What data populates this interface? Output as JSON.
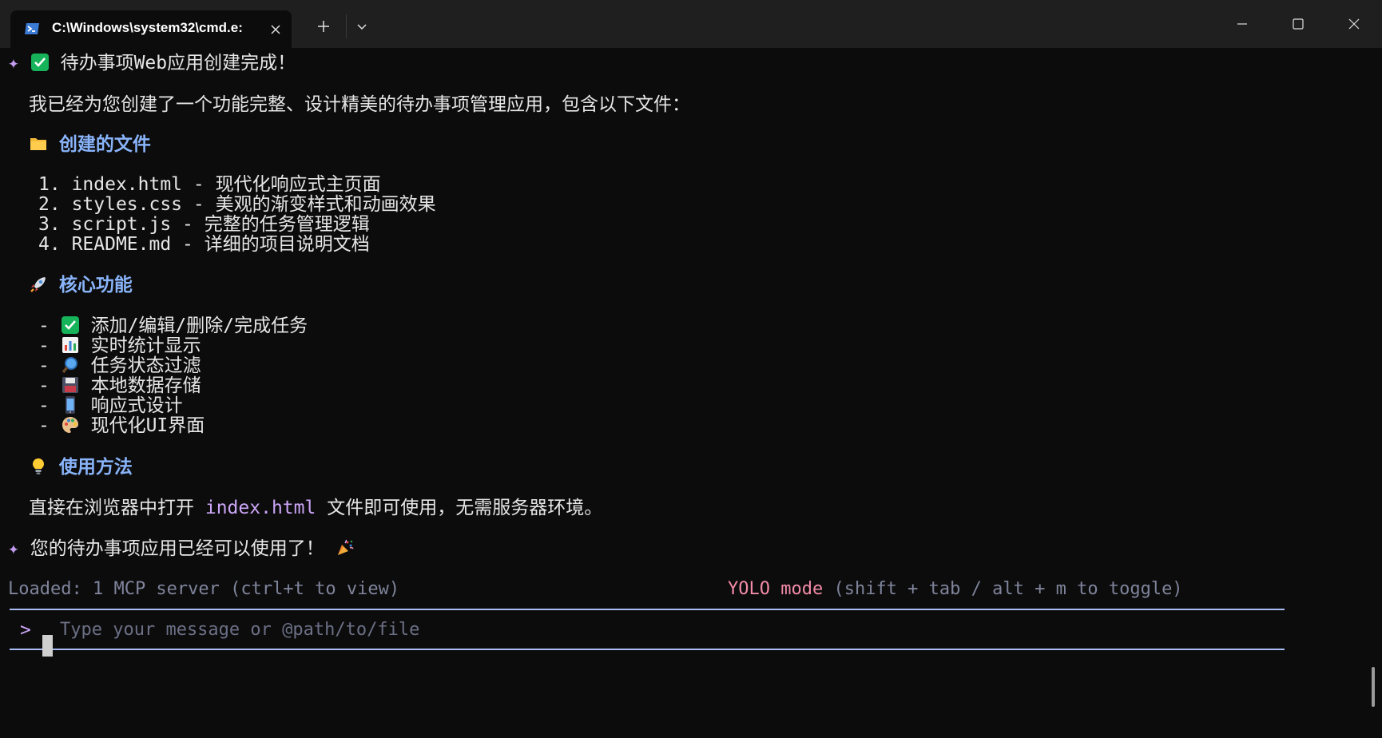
{
  "window": {
    "tab_title": "C:\\Windows\\system32\\cmd.e:",
    "icons": {
      "tab": "powershell-icon",
      "close_tab": "close-icon",
      "new_tab": "plus-icon",
      "dropdown": "chevron-down-icon",
      "minimize": "minimize-icon",
      "maximize": "maximize-icon",
      "close": "close-icon"
    }
  },
  "message": {
    "title": "待办事项Web应用创建完成！",
    "intro": "我已经为您创建了一个功能完整、设计精美的待办事项管理应用，包含以下文件：",
    "files_heading": "创建的文件",
    "files": [
      {
        "num": "1.",
        "name": "index.html",
        "desc": "现代化响应式主页面"
      },
      {
        "num": "2.",
        "name": "styles.css",
        "desc": "美观的渐变样式和动画效果"
      },
      {
        "num": "3.",
        "name": "script.js",
        "desc": "完整的任务管理逻辑"
      },
      {
        "num": "4.",
        "name": "README.md",
        "desc": "详细的项目说明文档"
      }
    ],
    "features_heading": "核心功能",
    "features": [
      {
        "icon": "check-icon",
        "text": "添加/编辑/删除/完成任务"
      },
      {
        "icon": "chart-icon",
        "text": "实时统计显示"
      },
      {
        "icon": "magnifier-icon",
        "text": "任务状态过滤"
      },
      {
        "icon": "floppy-disk-icon",
        "text": "本地数据存储"
      },
      {
        "icon": "mobile-phone-icon",
        "text": "响应式设计"
      },
      {
        "icon": "palette-icon",
        "text": "现代化UI界面"
      }
    ],
    "usage_heading": "使用方法",
    "usage_prefix": "直接在浏览器中打开 ",
    "usage_code": "index.html",
    "usage_suffix": " 文件即可使用，无需服务器环境。",
    "final": "您的待办事项应用已经可以使用了！"
  },
  "status": {
    "left": "Loaded: 1 MCP server (ctrl+t to view)",
    "yolo": "YOLO mode",
    "right": " (shift + tab / alt + m to toggle)"
  },
  "input": {
    "prompt": ">",
    "placeholder": "Type your message or @path/to/file"
  },
  "colors": {
    "background": "#0c0c0c",
    "heading": "#89b4fa",
    "accent_purple": "#cba6f7",
    "yolo": "#f38ba8",
    "muted": "#7f849c",
    "divider": "#a9bdf5"
  }
}
